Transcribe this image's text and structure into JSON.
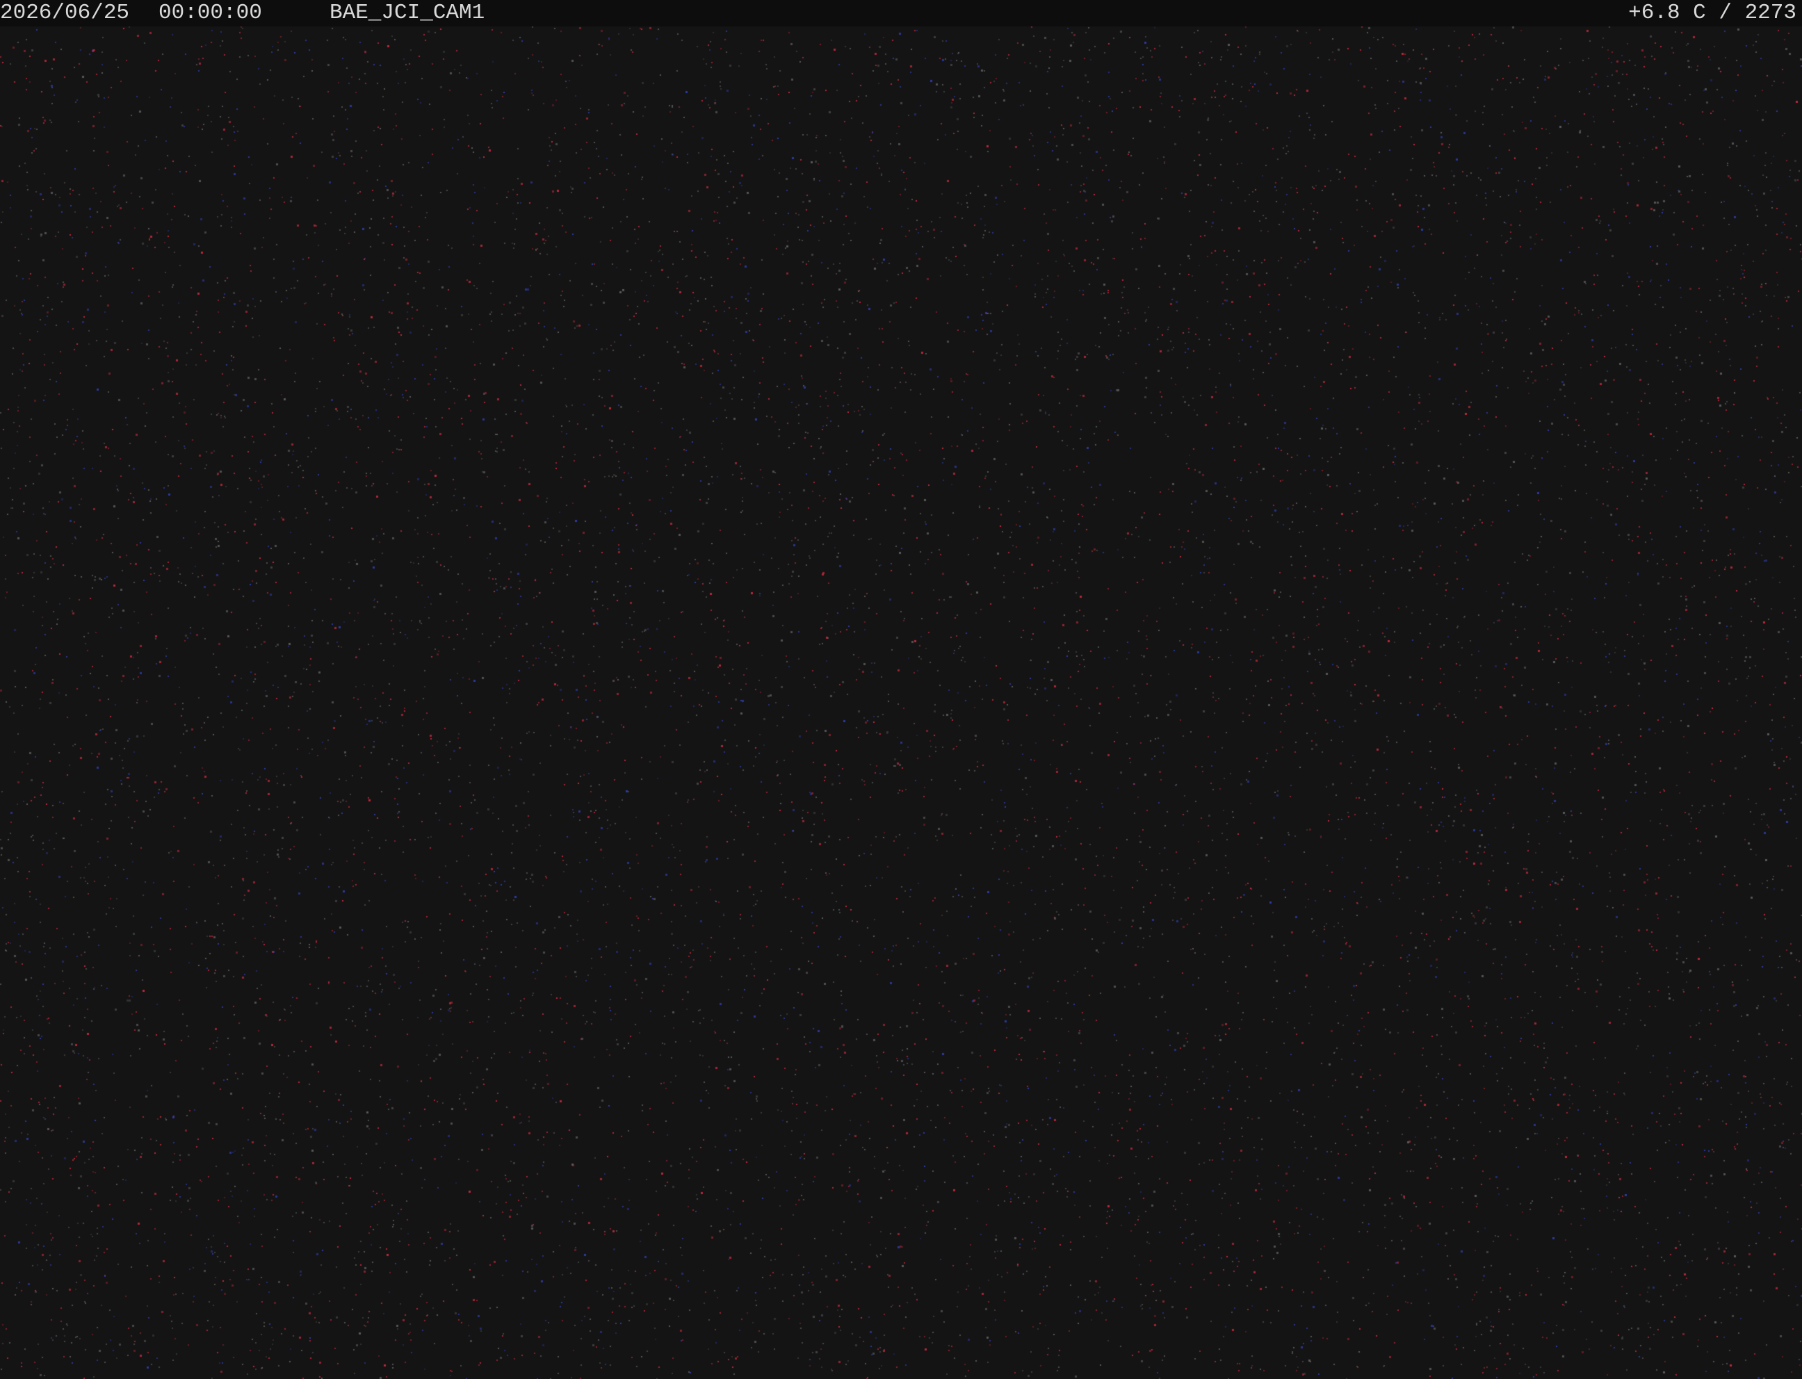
{
  "overlay": {
    "date": "2026/06/25",
    "time": "00:00:00",
    "camera_name": "BAE_JCI_CAM1",
    "temperature_and_value": "+6.8 C / 2273"
  },
  "colors": {
    "background": "#141414",
    "overlay_text": "#d9d9d9",
    "overlay_bar": "#0d0d0d",
    "noise_red": "#c0283a",
    "noise_gray": "#5a5a5a",
    "noise_blue": "#2c3ca8"
  },
  "feed": {
    "description_icon": "night-sensor-noise"
  }
}
